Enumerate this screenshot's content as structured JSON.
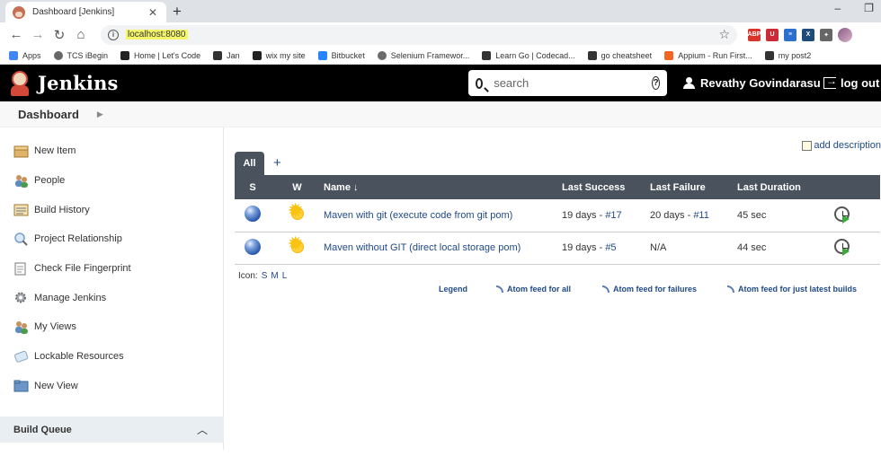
{
  "browser": {
    "tab_title": "Dashboard [Jenkins]",
    "url": "localhost:8080",
    "bookmarks": [
      {
        "label": "Apps",
        "color": "#4285f4"
      },
      {
        "label": "TCS iBegin",
        "color": "#666666"
      },
      {
        "label": "Home | Let's Code",
        "color": "#222222"
      },
      {
        "label": "Jan",
        "color": "#333333"
      },
      {
        "label": "wix my site",
        "color": "#222222"
      },
      {
        "label": "Bitbucket",
        "color": "#2684ff"
      },
      {
        "label": "Selenium Framewor...",
        "color": "#6b6b6b"
      },
      {
        "label": "Learn Go | Codecad...",
        "color": "#333333"
      },
      {
        "label": "go cheatsheet",
        "color": "#333333"
      },
      {
        "label": "Appium - Run First...",
        "color": "#f26522"
      },
      {
        "label": "my post2",
        "color": "#333333"
      }
    ],
    "extensions": [
      {
        "label": "ABP",
        "color": "#d9342b"
      },
      {
        "label": "U",
        "color": "#cc2a36"
      },
      {
        "label": "≡",
        "color": "#2d6fcf"
      },
      {
        "label": "X",
        "color": "#1f4b7a"
      },
      {
        "label": "✦",
        "color": "#666666"
      }
    ]
  },
  "header": {
    "brand": "Jenkins",
    "search_placeholder": "search",
    "help": "?",
    "user_name": "Revathy Govindarasu",
    "logout": "log out"
  },
  "breadcrumb": {
    "items": [
      "Dashboard"
    ]
  },
  "sidebar": {
    "items": [
      {
        "label": "New Item",
        "icon": "new-item-icon",
        "color": "#e0b36a"
      },
      {
        "label": "People",
        "icon": "people-icon",
        "color": "#5c8dc4"
      },
      {
        "label": "Build History",
        "icon": "build-history-icon",
        "color": "#c79a44"
      },
      {
        "label": "Project Relationship",
        "icon": "magnifier-icon",
        "color": "#7aa0c8"
      },
      {
        "label": "Check File Fingerprint",
        "icon": "fingerprint-icon",
        "color": "#7b7b7b"
      },
      {
        "label": "Manage Jenkins",
        "icon": "gear-icon",
        "color": "#8b8f96"
      },
      {
        "label": "My Views",
        "icon": "my-views-icon",
        "color": "#5c8dc4"
      },
      {
        "label": "Lockable Resources",
        "icon": "lock-icon",
        "color": "#8aa7c2"
      },
      {
        "label": "New View",
        "icon": "folder-icon",
        "color": "#5b86b7"
      }
    ],
    "build_queue": {
      "title": "Build Queue",
      "chevron": "^"
    }
  },
  "content": {
    "add_description": "add description",
    "tabs": [
      {
        "label": "All"
      }
    ],
    "add_tab": "+",
    "columns": [
      "S",
      "W",
      "Name ↓",
      "Last Success",
      "Last Failure",
      "Last Duration",
      ""
    ],
    "jobs": [
      {
        "name": "Maven with git (execute code from git pom)",
        "last_success": "19 days - ",
        "last_success_run": "#17",
        "last_failure": "20 days - ",
        "last_failure_run": "#11",
        "last_duration": "45 sec",
        "status_icon": "blue-ball-icon",
        "weather_icon": "sunny-icon"
      },
      {
        "name": "Maven without GIT (direct local storage pom)",
        "last_success": "19 days - ",
        "last_success_run": "#5",
        "last_failure": "N/A",
        "last_failure_run": "",
        "last_duration": "44 sec",
        "status_icon": "blue-ball-icon",
        "weather_icon": "sunny-icon"
      }
    ],
    "icon_label": "Icon:",
    "icon_sizes": [
      "S",
      "M",
      "L"
    ],
    "feeds": {
      "legend": "Legend",
      "atom_all": "Atom feed for all",
      "atom_failures": "Atom feed for failures",
      "atom_latest": "Atom feed for just latest builds"
    }
  },
  "colors": {
    "header_bg": "#000000",
    "table_header_bg": "#4a535d",
    "link": "#204a87",
    "url_highlight": "#f5f56a"
  }
}
